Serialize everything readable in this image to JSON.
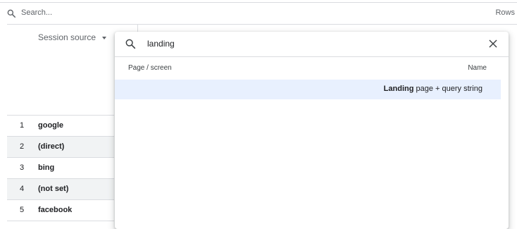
{
  "filter_bar": {
    "search_placeholder": "Search...",
    "rows_label": "Rows"
  },
  "table": {
    "dimension_header": "Session source",
    "rows": [
      {
        "index": "1",
        "name": "google"
      },
      {
        "index": "2",
        "name": "(direct)"
      },
      {
        "index": "3",
        "name": "bing"
      },
      {
        "index": "4",
        "name": "(not set)"
      },
      {
        "index": "5",
        "name": "facebook"
      }
    ]
  },
  "dimension_picker": {
    "search_value": "landing",
    "column_left": "Page / screen",
    "column_right": "Name",
    "results": [
      {
        "match": "Landing",
        "rest": " page + query string"
      }
    ]
  }
}
